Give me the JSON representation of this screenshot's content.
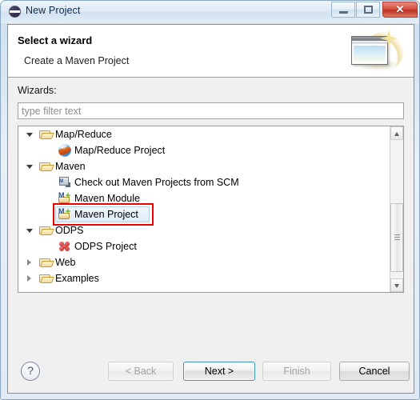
{
  "window": {
    "title": "New Project",
    "icon": "eclipse-icon",
    "controls": {
      "minimize": "minimize-button",
      "maximize": "maximize-button",
      "close": "✕"
    }
  },
  "header": {
    "title": "Select a wizard",
    "subtitle": "Create a Maven Project",
    "graphic": "wizard-banner-icon"
  },
  "form": {
    "wizards_label": "Wizards:",
    "filter": {
      "value": "",
      "placeholder": "type filter text"
    }
  },
  "tree": {
    "items": [
      {
        "label": "Map/Reduce",
        "indent": 0,
        "twisty": "expanded",
        "icon": "folder-icon",
        "selected": false
      },
      {
        "label": "Map/Reduce Project",
        "indent": 1,
        "twisty": "none",
        "icon": "globe-icon",
        "selected": false
      },
      {
        "label": "Maven",
        "indent": 0,
        "twisty": "expanded",
        "icon": "folder-icon",
        "selected": false
      },
      {
        "label": "Check out Maven Projects from SCM",
        "indent": 1,
        "twisty": "none",
        "icon": "scm-checkout-icon",
        "selected": false
      },
      {
        "label": "Maven Module",
        "indent": 1,
        "twisty": "none",
        "icon": "maven-icon",
        "selected": false
      },
      {
        "label": "Maven Project",
        "indent": 1,
        "twisty": "none",
        "icon": "maven-icon",
        "selected": true
      },
      {
        "label": "ODPS",
        "indent": 0,
        "twisty": "expanded",
        "icon": "folder-icon",
        "selected": false
      },
      {
        "label": "ODPS Project",
        "indent": 1,
        "twisty": "none",
        "icon": "odps-icon",
        "selected": false
      },
      {
        "label": "Web",
        "indent": 0,
        "twisty": "collapsed",
        "icon": "folder-icon",
        "selected": false
      },
      {
        "label": "Examples",
        "indent": 0,
        "twisty": "collapsed",
        "icon": "folder-icon",
        "selected": false
      }
    ],
    "scrollbar": {
      "up_arrow": "scroll-up-arrow",
      "down_arrow": "scroll-down-arrow"
    },
    "annotation": {
      "target_label": "Maven Project",
      "color": "#ee0000"
    }
  },
  "footer": {
    "help": "?",
    "buttons": [
      {
        "label": "< Back",
        "name": "back-button",
        "state": "disabled"
      },
      {
        "label": "Next >",
        "name": "next-button",
        "state": "default"
      },
      {
        "label": "Finish",
        "name": "finish-button",
        "state": "disabled"
      },
      {
        "label": "Cancel",
        "name": "cancel-button",
        "state": "enabled"
      }
    ]
  }
}
